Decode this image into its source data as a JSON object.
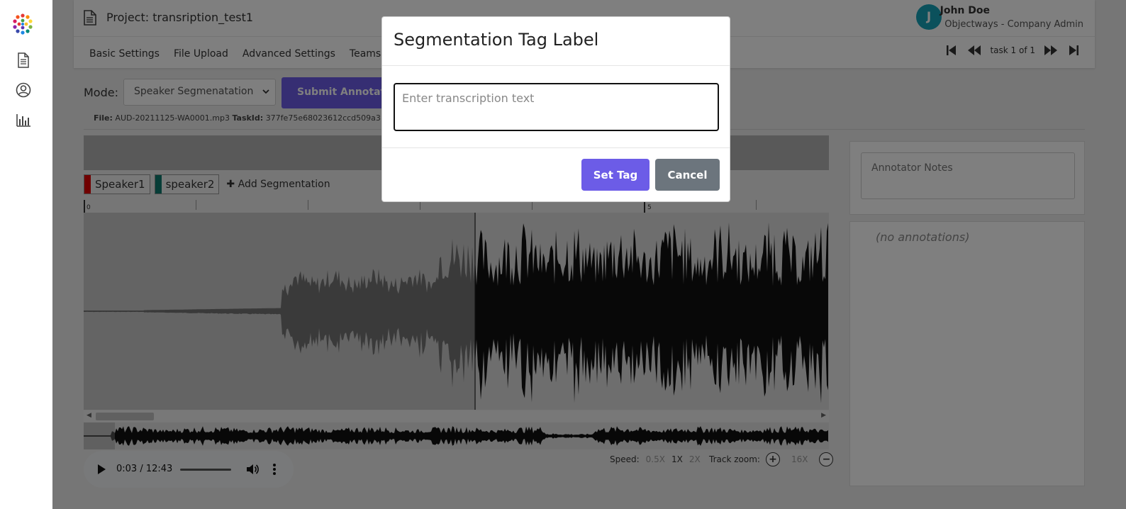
{
  "app": {
    "project_title": "Project: transription_test1",
    "user": {
      "initial": "J",
      "name": "John Doe",
      "role": "Objectways - Company Admin"
    },
    "sidebar_icons": [
      "document-icon",
      "user-icon",
      "chart-icon"
    ]
  },
  "nav": {
    "tabs": [
      {
        "label": "Basic Settings"
      },
      {
        "label": "File Upload"
      },
      {
        "label": "Advanced Settings"
      },
      {
        "label": "Teams"
      }
    ],
    "task_label": "task 1 of 1"
  },
  "controls": {
    "mode_label": "Mode:",
    "mode_value": "Speaker Segmenatation",
    "submit_label": "Submit Annotations",
    "file_label": "File:",
    "file_name": "AUD-20211125-WA0001.mp3",
    "task_id_label": "TaskId:",
    "task_id": "377fe75e68023612ccd509a3"
  },
  "segmentation": {
    "tags": [
      {
        "label": "Speaker1",
        "color": "#e00000"
      },
      {
        "label": "speaker2",
        "color": "#0f7a6e"
      }
    ],
    "add_label": "Add Segmentation",
    "timeline_labels": [
      "0",
      "5"
    ]
  },
  "player": {
    "time": "0:03 / 12:43",
    "speed_label": "Speed:",
    "speeds": [
      "0.5X",
      "1X",
      "2X"
    ],
    "zoom_label": "Track zoom:",
    "zoom_value": "16X"
  },
  "side": {
    "notes_placeholder": "Annotator Notes",
    "empty_annotations": "(no annotations)"
  },
  "modal": {
    "title": "Segmentation Tag Label",
    "input_placeholder": "Enter transcription text",
    "set_label": "Set Tag",
    "cancel_label": "Cancel"
  },
  "colors": {
    "accent": "#6c5ce7",
    "secondary": "#6c757d",
    "avatar": "#17a2b8"
  }
}
